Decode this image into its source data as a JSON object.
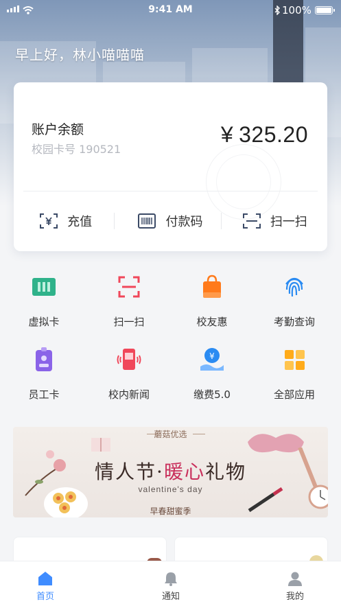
{
  "status_bar": {
    "time": "9:41 AM",
    "battery": "100%"
  },
  "greeting": "早上好，林小喵喵喵",
  "account": {
    "label": "账户余额",
    "card_number": "校园卡号 190521",
    "currency": "¥",
    "balance": "325.20"
  },
  "quick_actions": [
    {
      "label": "充值",
      "icon": "recharge-icon"
    },
    {
      "label": "付款码",
      "icon": "barcode-icon"
    },
    {
      "label": "扫一扫",
      "icon": "scan-icon"
    }
  ],
  "apps": [
    {
      "label": "虚拟卡",
      "icon": "virtual-card-icon",
      "color": "#2fb28a"
    },
    {
      "label": "扫一扫",
      "icon": "scan-icon",
      "color": "#f0475a"
    },
    {
      "label": "校友惠",
      "icon": "shopping-bag-icon",
      "color": "#ff7a1a"
    },
    {
      "label": "考勤查询",
      "icon": "fingerprint-icon",
      "color": "#2a8bf2"
    },
    {
      "label": "员工卡",
      "icon": "employee-card-icon",
      "color": "#8a63e8"
    },
    {
      "label": "校内新闻",
      "icon": "news-phone-icon",
      "color": "#f0475a"
    },
    {
      "label": "缴费5.0",
      "icon": "payment-hand-icon",
      "color": "#2a8bf2"
    },
    {
      "label": "全部应用",
      "icon": "all-apps-icon",
      "color": "#ffab1a"
    }
  ],
  "banner": {
    "tag": "蘑菇优选",
    "title_pre": "情人节·",
    "title_highlight": "暖心",
    "title_post": "礼物",
    "subtitle": "valentine's day",
    "footer": "早春甜蜜季"
  },
  "tabbar": [
    {
      "label": "首页",
      "icon": "home-icon",
      "active": true
    },
    {
      "label": "通知",
      "icon": "bell-icon",
      "active": false
    },
    {
      "label": "我的",
      "icon": "user-icon",
      "active": false
    }
  ],
  "colors": {
    "accent": "#3f8cff",
    "banner_highlight": "#c9305c"
  }
}
